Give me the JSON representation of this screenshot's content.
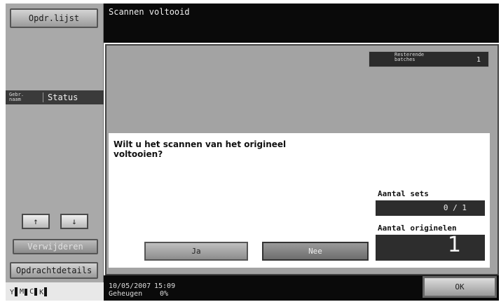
{
  "sidebar": {
    "job_list_label": "Opdr.lijst",
    "tab_user_label": "Gebr.\nnaam",
    "tab_status_label": "Status",
    "up_arrow": "↑",
    "down_arrow": "↓",
    "delete_label": "Verwijderen",
    "details_label": "Opdrachtdetails",
    "toner": [
      {
        "letter": "Y",
        "level": 0.95
      },
      {
        "letter": "M",
        "level": 0.7
      },
      {
        "letter": "C",
        "level": 0.75
      },
      {
        "letter": "K",
        "level": 0.95
      }
    ]
  },
  "header": {
    "title": "Scannen voltooid"
  },
  "panel": {
    "remaining_label": "Resterende\nbatches",
    "remaining_value": "1"
  },
  "dialog": {
    "question": "Wilt u het scannen van het origineel voltooien?",
    "sets_label": "Aantal sets",
    "sets_value": "0 / 1",
    "originals_label": "Aantal originelen",
    "originals_value": "1",
    "yes_label": "Ja",
    "no_label": "Nee"
  },
  "footer": {
    "date": "10/05/2007",
    "memory_label": "Geheugen",
    "time": "15:09",
    "memory_value": "0%",
    "ok_label": "OK"
  },
  "colors": {
    "title_bg": "#0a0a0a",
    "panel_bg": "#a3a3a3",
    "sidebar_bg": "#a9a9a9"
  }
}
